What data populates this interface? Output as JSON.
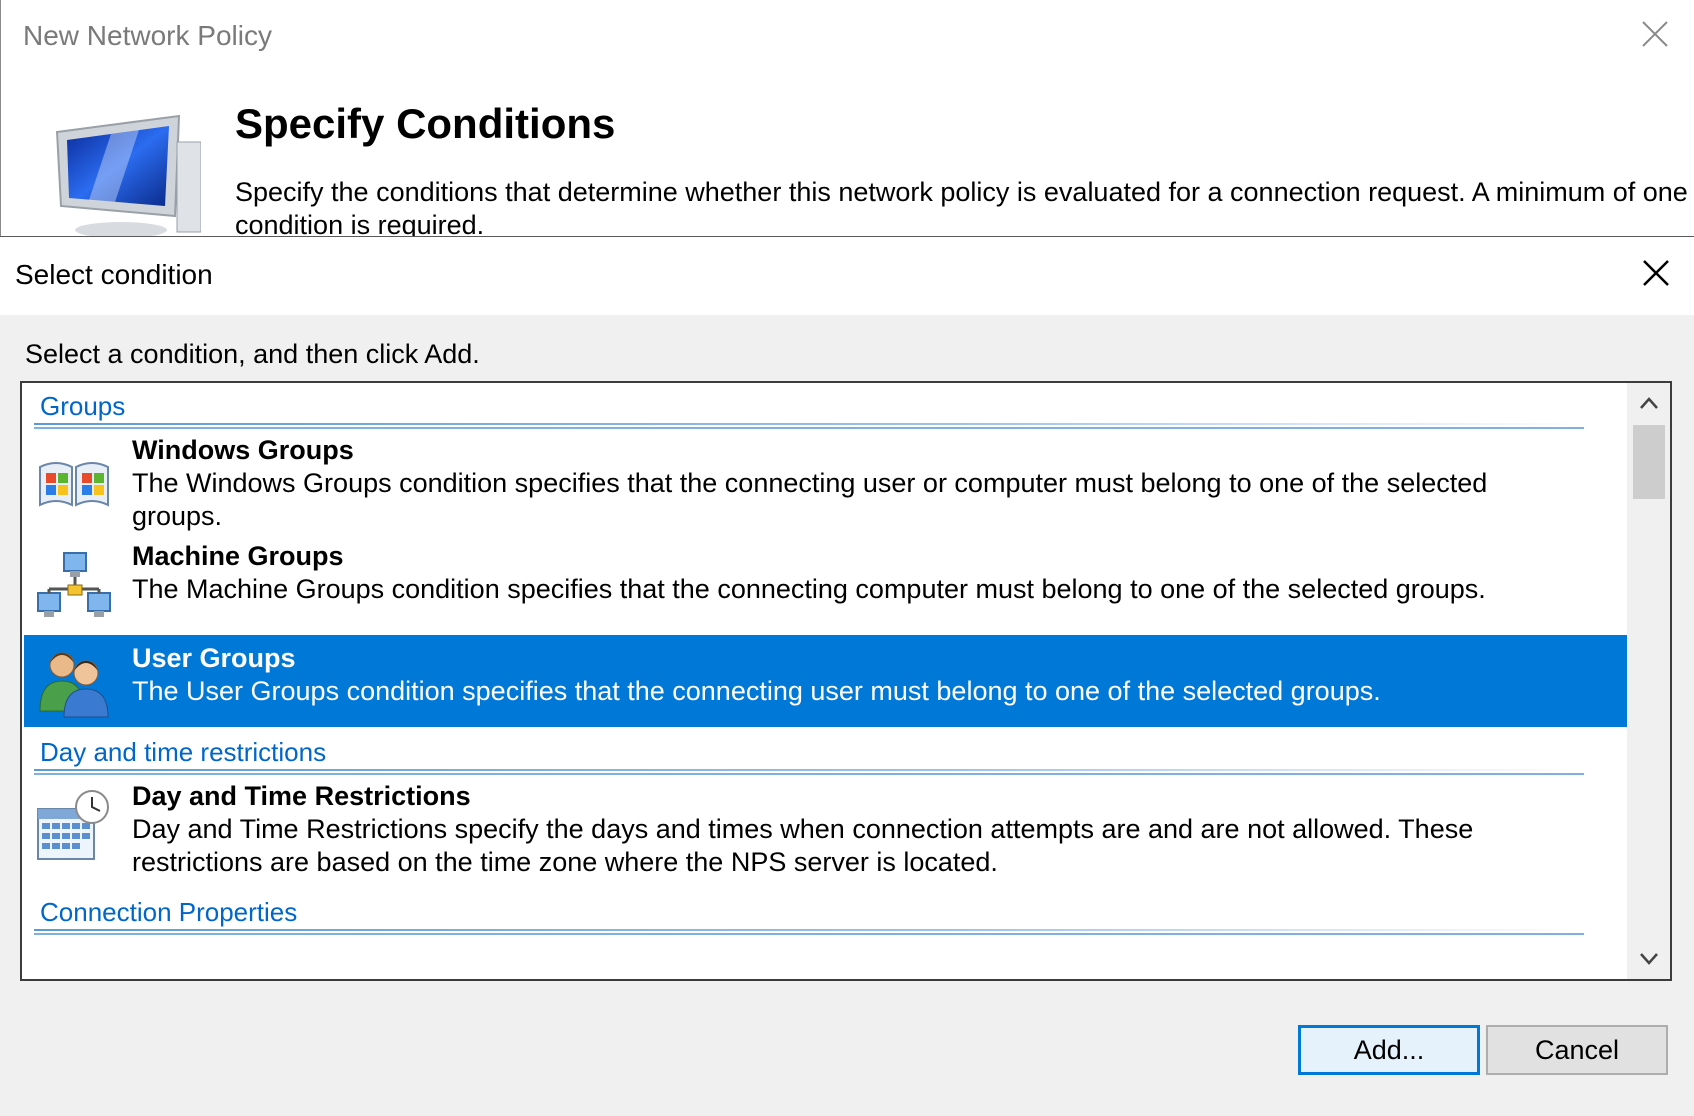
{
  "wizard": {
    "title": "New Network Policy",
    "heading": "Specify Conditions",
    "description": "Specify the conditions that determine whether this network policy is evaluated for a connection request. A minimum of one condition is required.",
    "icon": "monitor-icon",
    "close_icon": "close-icon"
  },
  "dialog": {
    "title": "Select condition",
    "instruction": "Select a condition, and then click Add.",
    "close_icon": "close-icon",
    "groups": [
      {
        "header": "Groups",
        "items": [
          {
            "title": "Windows Groups",
            "description": "The Windows Groups condition specifies that the connecting user or computer must belong to one of the selected groups.",
            "icon": "windows-groups-icon",
            "selected": false
          },
          {
            "title": "Machine Groups",
            "description": "The Machine Groups condition specifies that the connecting computer must belong to one of the selected groups.",
            "icon": "machine-groups-icon",
            "selected": false
          },
          {
            "title": "User Groups",
            "description": "The User Groups condition specifies that the connecting user must belong to one of the selected groups.",
            "icon": "user-groups-icon",
            "selected": true
          }
        ]
      },
      {
        "header": "Day and time restrictions",
        "items": [
          {
            "title": "Day and Time Restrictions",
            "description": "Day and Time Restrictions specify the days and times when connection attempts are and are not allowed. These restrictions are based on the time zone where the NPS server is located.",
            "icon": "calendar-clock-icon",
            "selected": false
          }
        ]
      },
      {
        "header": "Connection Properties",
        "items": []
      }
    ],
    "buttons": {
      "add_label": "Add...",
      "cancel_label": "Cancel"
    }
  },
  "colors": {
    "selection": "#0078d7",
    "group_header": "#0066cc",
    "dialog_bg": "#f0f0f0"
  }
}
